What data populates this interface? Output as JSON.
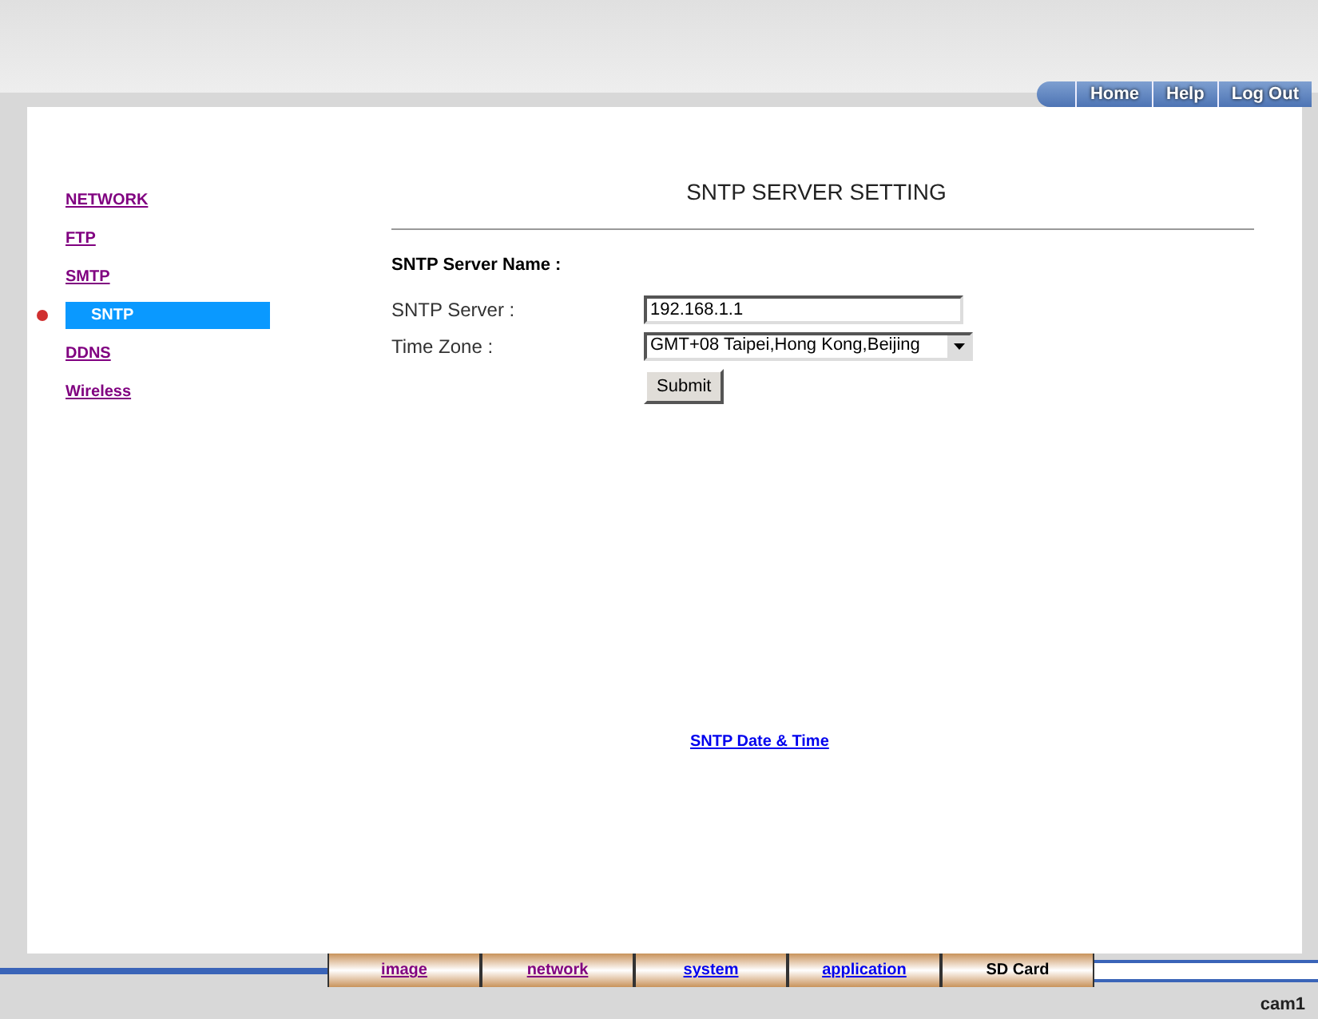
{
  "header_buttons": [
    "Home",
    "Help",
    "Log Out"
  ],
  "sidebar": {
    "items": [
      {
        "label": "NETWORK",
        "selected": false
      },
      {
        "label": "FTP",
        "selected": false
      },
      {
        "label": "SMTP",
        "selected": false
      },
      {
        "label": "SNTP",
        "selected": true
      },
      {
        "label": "DDNS",
        "selected": false
      },
      {
        "label": "Wireless",
        "selected": false
      }
    ]
  },
  "title": "SNTP SERVER SETTING",
  "section": "SNTP Server Name :",
  "fields": [
    {
      "kind": "text",
      "label": "SNTP Server :",
      "value": "192.168.1.1"
    },
    {
      "kind": "select",
      "label": "Time Zone :",
      "value": "GMT+08 Taipei,Hong Kong,Beijing"
    }
  ],
  "submit": "Submit",
  "date_time_link": "SNTP Date & Time",
  "bottom_tabs": [
    {
      "label": "image",
      "selected": false,
      "visited": true
    },
    {
      "label": "network",
      "selected": false,
      "visited": true
    },
    {
      "label": "system",
      "selected": false,
      "visited": false
    },
    {
      "label": "application",
      "selected": false,
      "visited": false
    },
    {
      "label": "SD Card",
      "selected": true
    }
  ],
  "device_name": "cam1"
}
